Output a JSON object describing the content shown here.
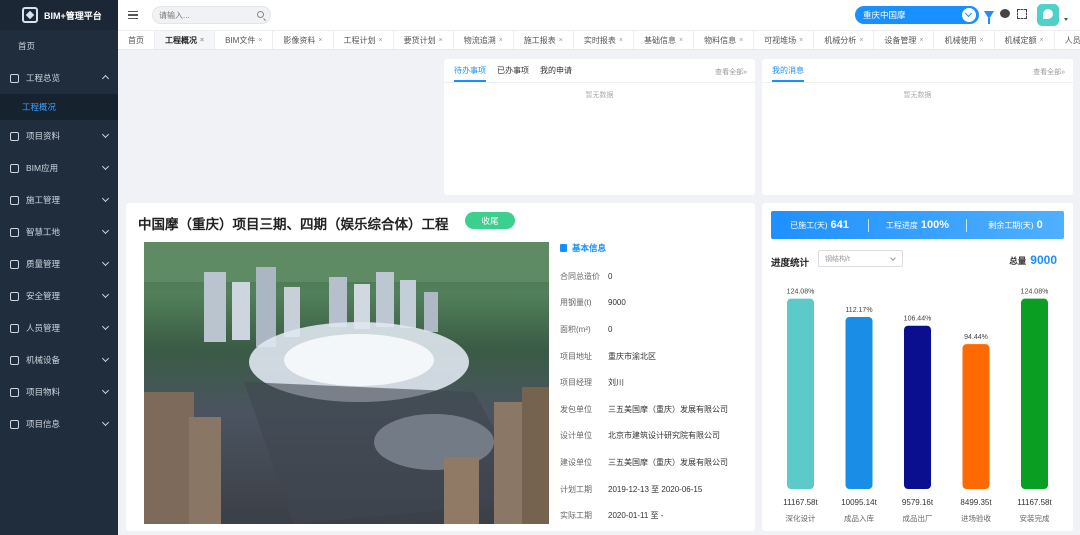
{
  "app": {
    "title": "BIM+管理平台"
  },
  "sidebar": {
    "home": "首页",
    "items": [
      {
        "label": "工程总览",
        "icon": "home-icon",
        "expanded": true,
        "children": [
          {
            "label": "工程概况",
            "active": true
          }
        ]
      },
      {
        "label": "项目资料",
        "icon": "document-icon"
      },
      {
        "label": "BIM应用",
        "icon": "cube-icon"
      },
      {
        "label": "施工管理",
        "icon": "clipboard-icon"
      },
      {
        "label": "智慧工地",
        "icon": "hammer-icon"
      },
      {
        "label": "质量管理",
        "icon": "checklist-icon"
      },
      {
        "label": "安全管理",
        "icon": "cloud-icon"
      },
      {
        "label": "人员管理",
        "icon": "user-icon"
      },
      {
        "label": "机械设备",
        "icon": "drill-icon"
      },
      {
        "label": "项目物料",
        "icon": "box-icon"
      },
      {
        "label": "项目信息",
        "icon": "list-icon"
      }
    ]
  },
  "topbar": {
    "search_placeholder": "请输入...",
    "project": "重庆中国摩",
    "icons": [
      "menu-icon",
      "search-icon",
      "filter-icon",
      "chat-icon",
      "fullscreen-icon",
      "avatar"
    ]
  },
  "tabs": [
    {
      "label": "首页",
      "closable": false
    },
    {
      "label": "工程概况",
      "active": true
    },
    {
      "label": "BIM文件"
    },
    {
      "label": "影像资料"
    },
    {
      "label": "工程计划"
    },
    {
      "label": "要货计划"
    },
    {
      "label": "物流追溯"
    },
    {
      "label": "施工报表"
    },
    {
      "label": "实时报表"
    },
    {
      "label": "基础信息"
    },
    {
      "label": "物料信息"
    },
    {
      "label": "可视堆场"
    },
    {
      "label": "机械分析"
    },
    {
      "label": "设备管理"
    },
    {
      "label": "机械使用"
    },
    {
      "label": "机械定额"
    },
    {
      "label": "人员信息"
    }
  ],
  "todo_panel": {
    "tabs": [
      "待办事项",
      "已办事项",
      "我的申请"
    ],
    "view_all": "查看全部»",
    "empty": "暂无数据"
  },
  "messages_panel": {
    "tabs": [
      "我的消息"
    ],
    "view_all": "查看全部»",
    "empty": "暂无数据"
  },
  "project": {
    "title": "中国摩（重庆）项目三期、四期（娱乐综合体）工程",
    "status": "收尾",
    "info_title": "基本信息",
    "info": [
      {
        "key": "合同总造价",
        "value": "0"
      },
      {
        "key": "用钢量(t)",
        "value": "9000"
      },
      {
        "key": "面积(m²)",
        "value": "0"
      },
      {
        "key": "项目地址",
        "value": "重庆市渝北区"
      },
      {
        "key": "项目经理",
        "value": "刘川"
      },
      {
        "key": "发包单位",
        "value": "三五美国摩（重庆）发展有限公司"
      },
      {
        "key": "设计单位",
        "value": "北京市建筑设计研究院有限公司"
      },
      {
        "key": "建设单位",
        "value": "三五美国摩（重庆）发展有限公司"
      },
      {
        "key": "计划工期",
        "value": "2019-12-13 至 2020-06-15"
      },
      {
        "key": "实际工期",
        "value": "2020-01-11 至 -"
      }
    ]
  },
  "progress": {
    "stats": [
      {
        "label": "已施工(天)",
        "value": "641"
      },
      {
        "label": "工程进度",
        "value": "100%"
      },
      {
        "label": "剩余工期(天)",
        "value": "0"
      }
    ],
    "title": "进度统计",
    "unit_placeholder": "钢结构/t",
    "total_label": "总量",
    "total_value": "9000"
  },
  "chart_data": {
    "type": "bar",
    "categories": [
      "深化设计",
      "成品入库",
      "成品出厂",
      "进场验收",
      "安装完成"
    ],
    "values": [
      11167.58,
      10095.14,
      9579.16,
      8499.35,
      11167.58
    ],
    "value_labels": [
      "11167.58t",
      "10095.14t",
      "9579.16t",
      "8499.35t",
      "11167.58t"
    ],
    "percent_labels": [
      "124.08%",
      "112.17%",
      "106.44%",
      "94.44%",
      "124.08%"
    ],
    "colors": [
      "#5ccac8",
      "#1a8ee6",
      "#0a0f8f",
      "#ff6a00",
      "#0a9e22"
    ],
    "ylim": [
      0,
      11500
    ],
    "grid": false,
    "legend": "none"
  }
}
